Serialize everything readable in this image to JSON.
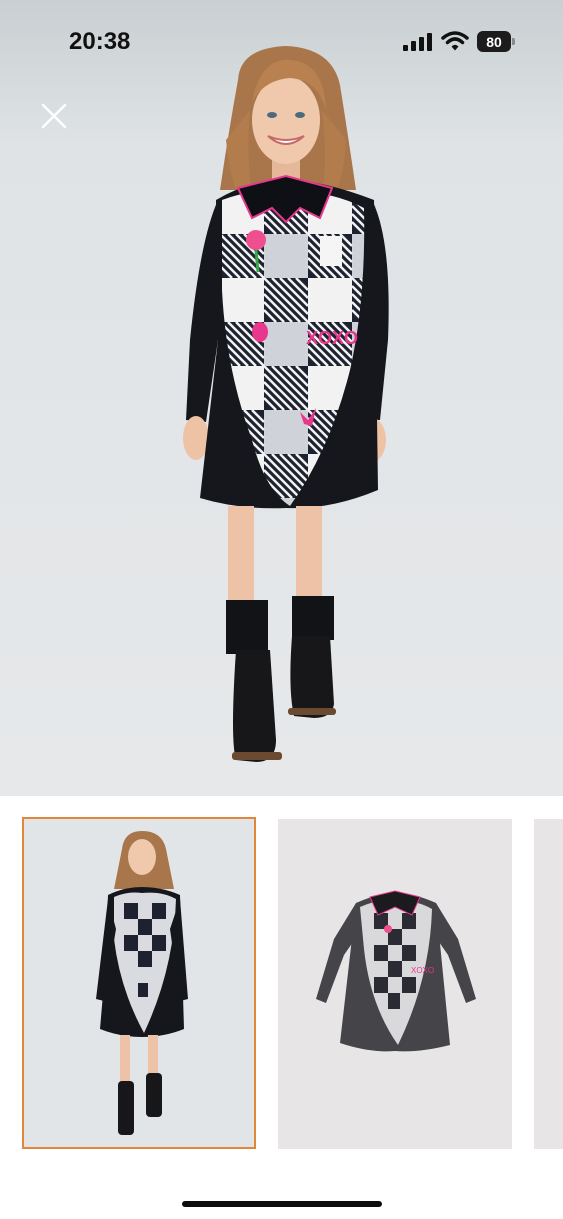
{
  "status_bar": {
    "time": "20:38",
    "battery_level": "80",
    "icons": [
      "signal-icon",
      "wifi-icon",
      "battery-icon"
    ]
  },
  "viewer": {
    "close_icon": "close-icon",
    "main_image": "product-photo-girl-wearing-black-white-check-dress",
    "selected_thumbnail_index": 0
  },
  "thumbnails": [
    {
      "image": "model-photo"
    },
    {
      "image": "dress-flat-photo"
    },
    {
      "image": "partial-next-photo"
    }
  ],
  "colors": {
    "selected_border": "#e0873a",
    "hero_background": "#e3e6e8",
    "dress_black": "#16171d",
    "accent_pink": "#e8378d"
  }
}
